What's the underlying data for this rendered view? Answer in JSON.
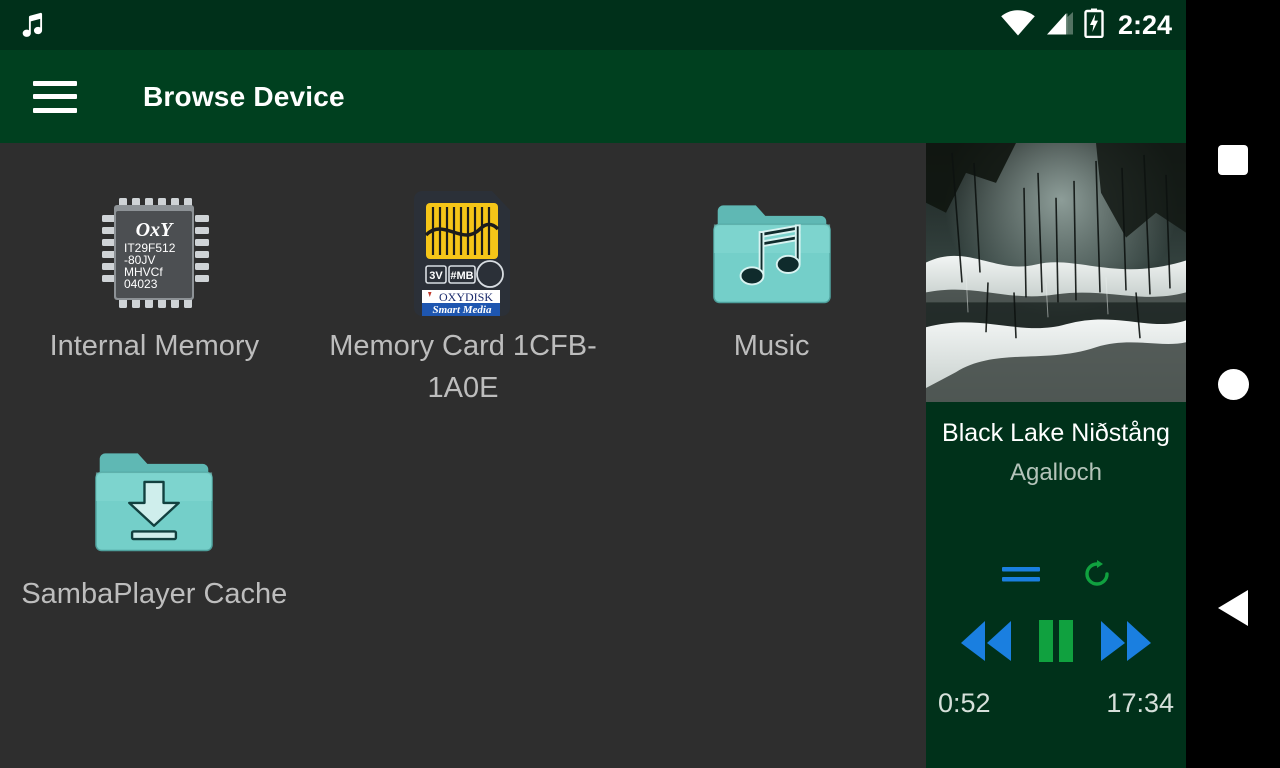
{
  "statusbar": {
    "notification_icon": "music-note-icon",
    "wifi_icon": "wifi-icon",
    "signal_icon": "cell-signal-icon",
    "battery_icon": "battery-charging-icon",
    "clock": "2:24"
  },
  "toolbar": {
    "menu_icon": "hamburger-menu-icon",
    "title": "Browse Device"
  },
  "content": {
    "items": [
      {
        "label": "Internal Memory",
        "icon": "memory-chip-icon",
        "chip": {
          "brand": "OxY",
          "line1": "IT29F512",
          "line2": "-80JV",
          "line3": "MHVCf",
          "line4": "04023"
        }
      },
      {
        "label": "Memory Card 1CFB-1A0E",
        "icon": "sd-card-icon",
        "card": {
          "voltage": "3V",
          "capacity": "#MB",
          "brand": "OXYDISK",
          "type": "Smart Media"
        }
      },
      {
        "label": "Music",
        "icon": "music-folder-icon"
      },
      {
        "label": "SambaPlayer Cache",
        "icon": "download-folder-icon"
      }
    ]
  },
  "nowplaying": {
    "album_art_icon": "album-art-snowy-forest",
    "title": "Black Lake Niðstång",
    "artist": "Agalloch",
    "shuffle_icon": "shuffle-off-icon",
    "repeat_icon": "repeat-icon",
    "rewind_icon": "rewind-icon",
    "pause_icon": "pause-icon",
    "forward_icon": "fast-forward-icon",
    "elapsed": "0:52",
    "duration": "17:34"
  },
  "navbar": {
    "recents_icon": "recents-square-icon",
    "home_icon": "home-circle-icon",
    "back_icon": "back-triangle-icon"
  },
  "colors": {
    "statusbar_bg": "#00301a",
    "toolbar_bg": "#00401f",
    "content_bg": "#2e2e2e",
    "nowplaying_bg": "#00311a",
    "folder_teal": "#74cfc9",
    "accent_blue": "#1a7fe0",
    "accent_green": "#10a13f",
    "label_gray": "#bdbdbd"
  }
}
